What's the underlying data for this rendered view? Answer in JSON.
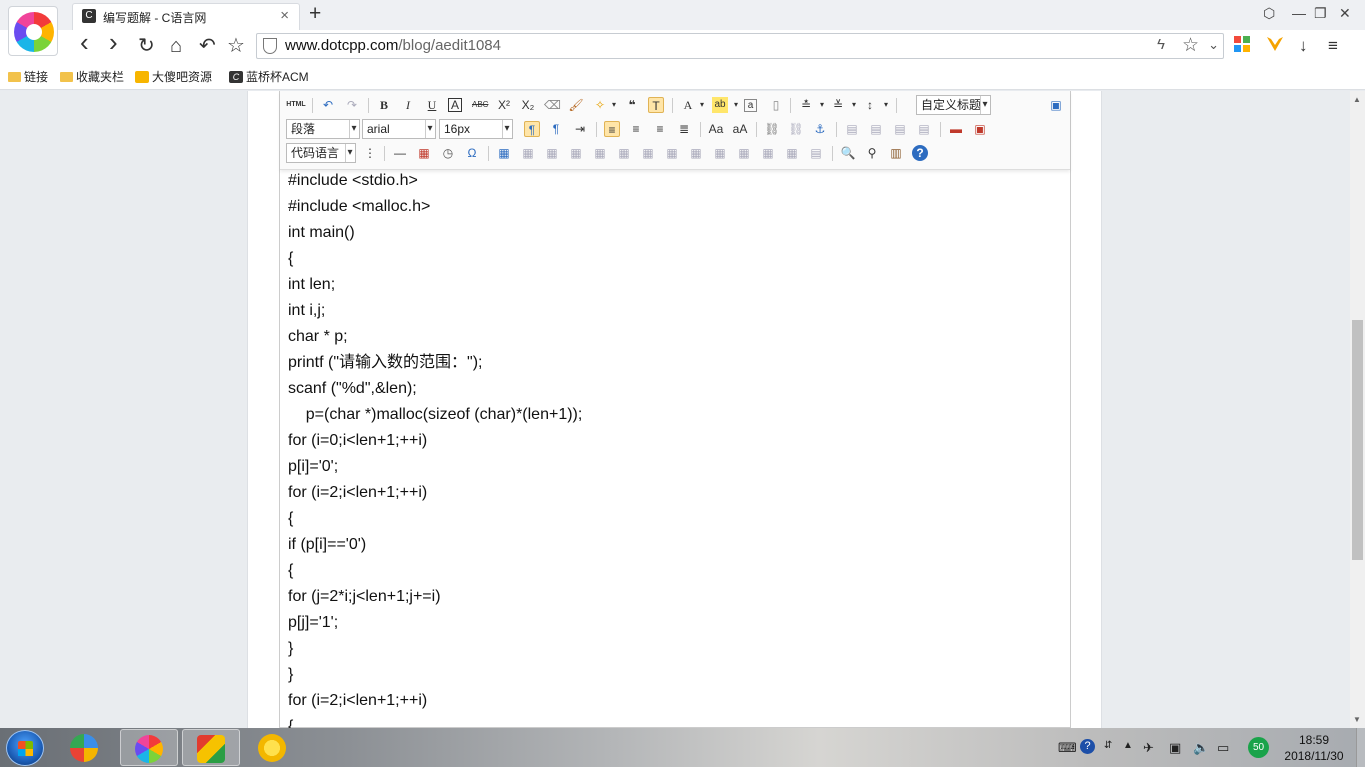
{
  "browser": {
    "tab_title": "编写题解 - C语言网",
    "tab_favicon": "C",
    "new_tab": "+",
    "tab_close": "×",
    "url_host": "www.dotcpp.com",
    "url_path": "/blog/aedit1084",
    "nav": {
      "back": "‹",
      "forward": "›",
      "reload": "↻",
      "home": "⌂",
      "undo": "↶",
      "favorite": "☆"
    },
    "window": {
      "skin": "⬡",
      "minimize": "—",
      "maximize": "❐",
      "close": "✕"
    }
  },
  "bookmarks": [
    {
      "label": "链接",
      "icon": "folder-icon"
    },
    {
      "label": "收藏夹栏",
      "icon": "folder-icon"
    },
    {
      "label": "大傻吧资源",
      "icon": "hand-icon"
    },
    {
      "label": "蓝桥杯ACM",
      "icon": "c-logo-icon"
    }
  ],
  "editor": {
    "toolbar": {
      "html_label": "HTML",
      "paragraph": "段落",
      "font_family": "arial",
      "font_size": "16px",
      "custom_title": "自定义标题",
      "code_language": "代码语言"
    },
    "code_lines": [
      "#include <stdio.h>",
      "#include <malloc.h>",
      "int main()",
      "{",
      "int len;",
      "int i,j;",
      "char * p;",
      "printf (\"请输入数的范围：\");",
      "scanf (\"%d\",&len);",
      "    p=(char *)malloc(sizeof (char)*(len+1));",
      "for (i=0;i<len+1;++i)",
      "p[i]='0';",
      "for (i=2;i<len+1;++i)",
      "{",
      "if (p[i]=='0')",
      "{",
      "for (j=2*i;j<len+1;j+=i)",
      "p[j]='1';",
      "}",
      "}",
      "for (i=2;i<len+1;++i)",
      "{"
    ]
  },
  "taskbar": {
    "tray_badge": "50",
    "time": "18:59",
    "date": "2018/11/30"
  }
}
